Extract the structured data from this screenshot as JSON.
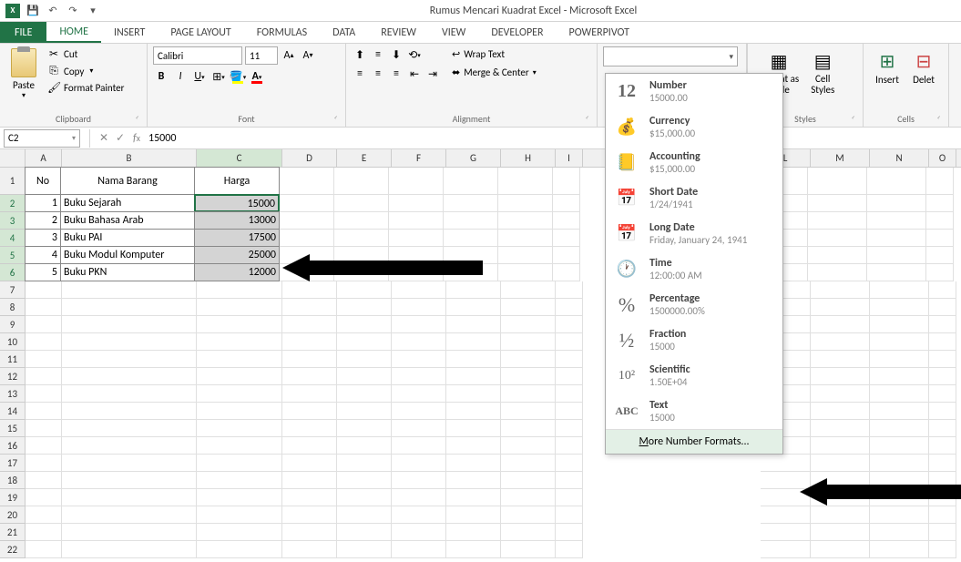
{
  "title": "Rumus Mencari Kuadrat Excel - Microsoft Excel",
  "tabs": {
    "file": "FILE",
    "home": "HOME",
    "insert": "INSERT",
    "pagelayout": "PAGE LAYOUT",
    "formulas": "FORMULAS",
    "data": "DATA",
    "review": "REVIEW",
    "view": "VIEW",
    "developer": "DEVELOPER",
    "powerpivot": "POWERPIVOT"
  },
  "clipboard": {
    "paste": "Paste",
    "cut": "Cut",
    "copy": "Copy",
    "format_painter": "Format Painter",
    "label": "Clipboard"
  },
  "font": {
    "name": "Calibri",
    "size": "11",
    "label": "Font"
  },
  "alignment": {
    "wrap": "Wrap Text",
    "merge": "Merge & Center",
    "label": "Alignment"
  },
  "styles": {
    "format_table": "Format as\nTable",
    "cell_styles": "Cell\nStyles",
    "label": "Styles"
  },
  "cells": {
    "insert": "Insert",
    "delete": "Delet",
    "label": "Cells"
  },
  "namebox": "C2",
  "formula_value": "15000",
  "columns": [
    "A",
    "B",
    "C",
    "D",
    "E",
    "F",
    "G",
    "H",
    "I",
    "L",
    "M",
    "N",
    "O"
  ],
  "headers": {
    "no": "No",
    "nama": "Nama Barang",
    "harga": "Harga"
  },
  "data_rows": [
    {
      "no": "1",
      "nama": "Buku Sejarah",
      "harga": "15000"
    },
    {
      "no": "2",
      "nama": "Buku Bahasa Arab",
      "harga": "13000"
    },
    {
      "no": "3",
      "nama": "Buku PAI",
      "harga": "17500"
    },
    {
      "no": "4",
      "nama": "Buku Modul Komputer",
      "harga": "25000"
    },
    {
      "no": "5",
      "nama": "Buku PKN",
      "harga": "12000"
    }
  ],
  "dropdown": {
    "items": [
      {
        "icon": "12",
        "title": "Number",
        "sub": "15000.00"
      },
      {
        "icon": "💰",
        "title": "Currency",
        "sub": "$15,000.00"
      },
      {
        "icon": "📒",
        "title": "Accounting",
        "sub": "$15,000.00"
      },
      {
        "icon": "📅",
        "title": "Short Date",
        "sub": "1/24/1941"
      },
      {
        "icon": "📅",
        "title": "Long Date",
        "sub": "Friday, January 24, 1941"
      },
      {
        "icon": "🕐",
        "title": "Time",
        "sub": "12:00:00 AM"
      },
      {
        "icon": "%",
        "title": "Percentage",
        "sub": "1500000.00%"
      },
      {
        "icon": "½",
        "title": "Fraction",
        "sub": "15000"
      },
      {
        "icon": "10²",
        "title": "Scientific",
        "sub": "1.50E+04"
      },
      {
        "icon": "ABC",
        "title": "Text",
        "sub": "15000"
      }
    ],
    "more": "More Number Formats..."
  }
}
